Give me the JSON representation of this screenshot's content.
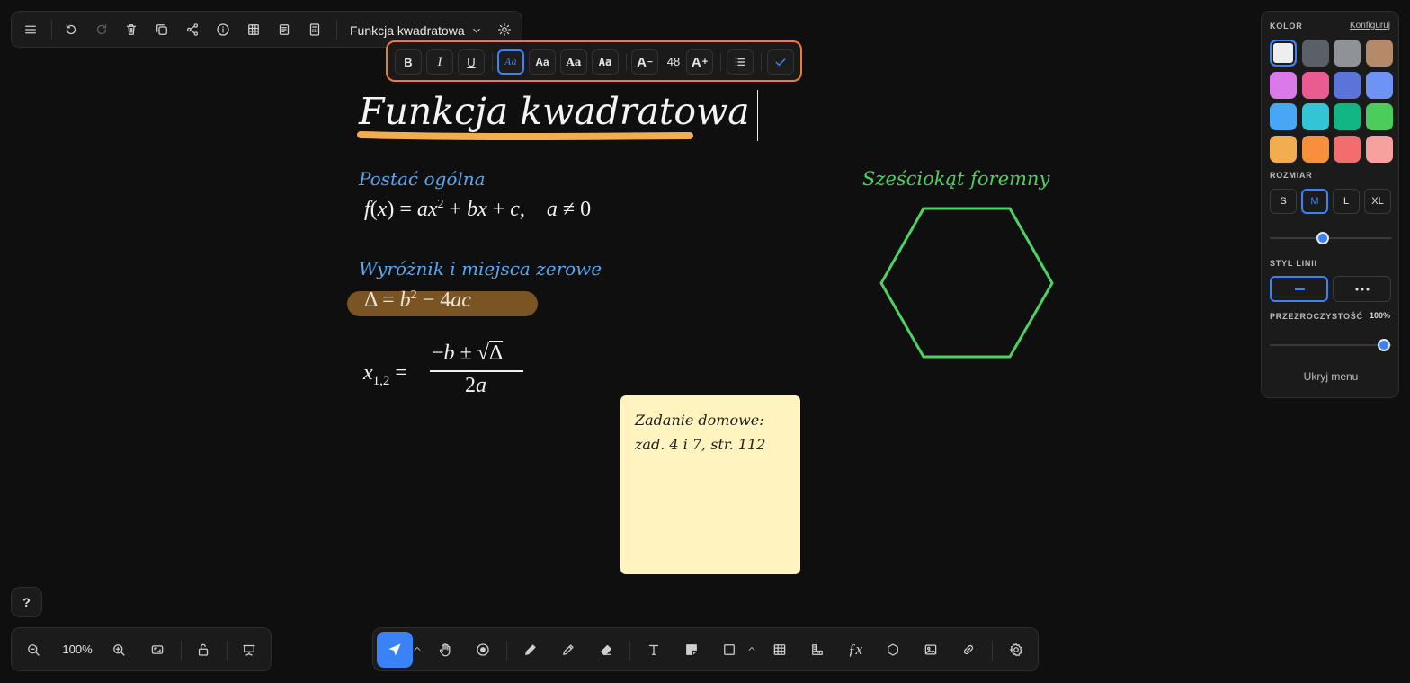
{
  "document": {
    "title": "Funkcja kwadratowa"
  },
  "format_toolbar": {
    "bold": "B",
    "italic": "I",
    "underline": "U",
    "font_styles": [
      "Aa",
      "Aa",
      "Aa",
      "Aa"
    ],
    "decrease_label": "A",
    "font_size": "48",
    "increase_label": "A"
  },
  "canvas": {
    "heading": "Funkcja kwadratowa",
    "section1": "Postać ogólna",
    "section2": "Wyróżnik i miejsca zerowe",
    "section3": "Sześciokąt foremny",
    "note": {
      "line1": "Zadanie domowe:",
      "line2": "zad. 4 i 7, str. 112"
    }
  },
  "style_panel": {
    "color_label": "KOLOR",
    "configure": "Konfiguruj",
    "colors": [
      "#eeeeee",
      "#5a6068",
      "#8f9398",
      "#b48a6a",
      "#d97ae8",
      "#ea5c91",
      "#5b74d9",
      "#6e93f5",
      "#48a7f5",
      "#33c4d6",
      "#12b584",
      "#4ccc5c",
      "#f2ad4e",
      "#f78f3c",
      "#f26d6d",
      "#f7a0a0"
    ],
    "size_label": "ROZMIAR",
    "sizes": [
      "S",
      "M",
      "L",
      "XL"
    ],
    "line_style_label": "STYL LINII",
    "opacity_label": "PRZEZROCZYSTOŚĆ",
    "opacity_value": "100%",
    "hide_menu": "Ukryj menu"
  },
  "zoom": {
    "level": "100%"
  },
  "help": "?",
  "colors": {
    "accent": "#3b82f6",
    "highlight": "#f07b2c",
    "blue_text": "#5aa7f0",
    "green": "#4fd162",
    "note_bg": "#fff4c0"
  }
}
